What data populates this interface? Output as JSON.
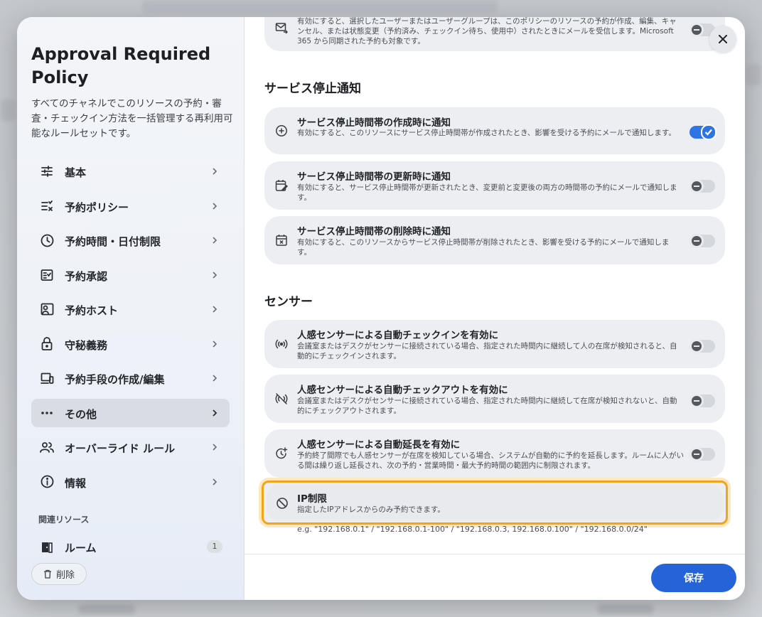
{
  "sidebar": {
    "title": "Approval Required Policy",
    "description": "すべてのチャネルでこのリソースの予約・審査・チェックイン方法を一括管理する再利用可能なルールセットです。",
    "nav": [
      {
        "label": "基本",
        "icon": "sliders-icon"
      },
      {
        "label": "予約ポリシー",
        "icon": "checklist-icon"
      },
      {
        "label": "予約時間・日付制限",
        "icon": "clock-icon"
      },
      {
        "label": "予約承認",
        "icon": "approval-icon"
      },
      {
        "label": "予約ホスト",
        "icon": "host-icon"
      },
      {
        "label": "守秘義務",
        "icon": "lock-icon"
      },
      {
        "label": "予約手段の作成/編集",
        "icon": "devices-icon"
      },
      {
        "label": "その他",
        "icon": "more-icon",
        "active": true
      },
      {
        "label": "オーバーライド ルール",
        "icon": "users-icon"
      },
      {
        "label": "情報",
        "icon": "info-icon"
      }
    ],
    "related_heading": "関連リソース",
    "related": {
      "label": "ルーム",
      "count": "1"
    },
    "delete_label": "削除"
  },
  "main": {
    "top_card": {
      "desc": "有効にすると、選択したユーザーまたはユーザーグループは、このポリシーのリソースの予約が作成、編集、キャンセル、または状態変更（予約済み、チェックイン待ち、使用中）されたときにメールを受信します。Microsoft 365 から同期された予約も対象です。",
      "enabled": false
    },
    "sections": [
      {
        "title": "サービス停止通知",
        "items": [
          {
            "title": "サービス停止時間帯の作成時に通知",
            "desc": "有効にすると、このリソースにサービス停止時間帯が作成されたとき、影響を受ける予約にメールで通知します。",
            "enabled": true,
            "icon": "plus-circle-icon"
          },
          {
            "title": "サービス停止時間帯の更新時に通知",
            "desc": "有効にすると、サービス停止時間帯が更新されたとき、変更前と変更後の両方の時間帯の予約にメールで通知します。",
            "enabled": false,
            "icon": "calendar-edit-icon"
          },
          {
            "title": "サービス停止時間帯の削除時に通知",
            "desc": "有効にすると、このリソースからサービス停止時間帯が削除されたとき、影響を受ける予約にメールで通知します。",
            "enabled": false,
            "icon": "calendar-x-icon"
          }
        ]
      },
      {
        "title": "センサー",
        "items": [
          {
            "title": "人感センサーによる自動チェックインを有効に",
            "desc": "会議室またはデスクがセンサーに接続されている場合、指定された時間内に継続して人の在席が検知されると、自動的にチェックインされます。",
            "enabled": false,
            "icon": "sensor-icon"
          },
          {
            "title": "人感センサーによる自動チェックアウトを有効に",
            "desc": "会議室またはデスクがセンサーに接続されている場合、指定された時間内に継続して在席が検知されないと、自動的にチェックアウトされます。",
            "enabled": false,
            "icon": "sensor-off-icon"
          },
          {
            "title": "人感センサーによる自動延長を有効に",
            "desc": "予約終了間際でも人感センサーが在席を検知している場合、システムが自動的に予約を延長します。ルームに人がいる間は繰り返し延長され、次の予約・営業時間・最大予約時間の範囲内に制限されます。",
            "enabled": false,
            "icon": "timer-plus-icon"
          }
        ]
      }
    ],
    "ip": {
      "title": "IP制限",
      "desc": "指定したIPアドレスからのみ予約できます。",
      "hint": "e.g. \"192.168.0.1\" / \"192.168.0.1-100\" / \"192.168.0.3, 192.168.0.100\" / \"192.168.0.0/24\"",
      "icon": "block-icon"
    }
  },
  "footer": {
    "save_label": "保存"
  },
  "colors": {
    "primary": "#2563d9",
    "highlight": "#f2a51a"
  }
}
